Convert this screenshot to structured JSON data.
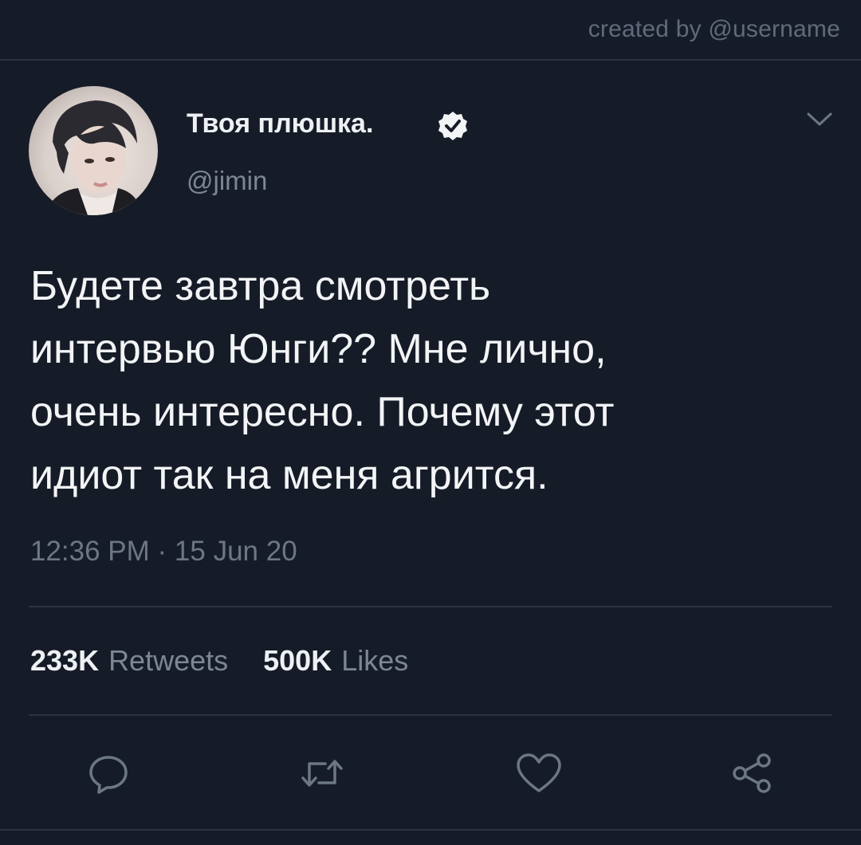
{
  "header": {
    "credit": "created by @username"
  },
  "author": {
    "display_name": "Твоя плюшка.",
    "handle": "@jimin",
    "verified": true,
    "avatar_icon": "profile-photo"
  },
  "tweet": {
    "text": "Будете завтра смотреть\nинтервью Юнги?? Мне лично,\nочень интересно. Почему этот\nидиот так на меня агрится.",
    "timestamp": "12:36 PM · 15 Jun 20"
  },
  "stats": {
    "retweets_count": "233K",
    "retweets_label": "Retweets",
    "likes_count": "500K",
    "likes_label": "Likes"
  },
  "actions": [
    {
      "icon": "reply-icon"
    },
    {
      "icon": "retweet-icon"
    },
    {
      "icon": "like-icon"
    },
    {
      "icon": "share-icon"
    }
  ],
  "colors": {
    "background": "#161c27",
    "text_primary": "#f2f4f6",
    "text_secondary": "#7c8793",
    "divider": "#2b3340"
  }
}
